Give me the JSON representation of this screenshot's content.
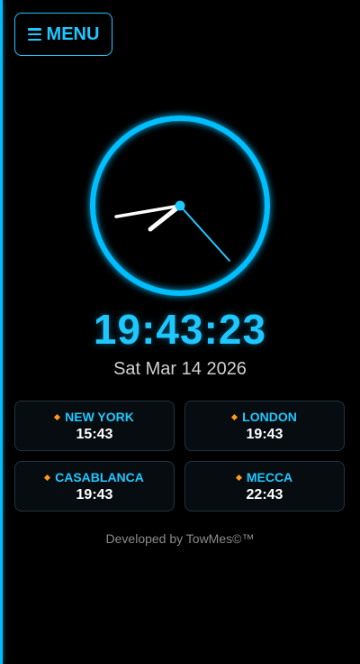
{
  "menu": {
    "label": "MENU",
    "icon": "hamburger-icon"
  },
  "clock": {
    "hour": 19,
    "minute": 43,
    "second": 23,
    "ring_color": "#00bfff",
    "hand_color": "#ffffff",
    "second_hand_color": "#1ec8ff"
  },
  "digital_time": "19:43:23",
  "date": "Sat Mar 14 2026",
  "world_clocks": [
    {
      "city": "NEW YORK",
      "time": "15:43"
    },
    {
      "city": "LONDON",
      "time": "19:43"
    },
    {
      "city": "CASABLANCA",
      "time": "19:43"
    },
    {
      "city": "MECCA",
      "time": "22:43"
    }
  ],
  "footer": "Developed by TowMes©™",
  "colors": {
    "accent": "#1ec8ff",
    "marker": "#ff9a1f",
    "background": "#000000"
  }
}
